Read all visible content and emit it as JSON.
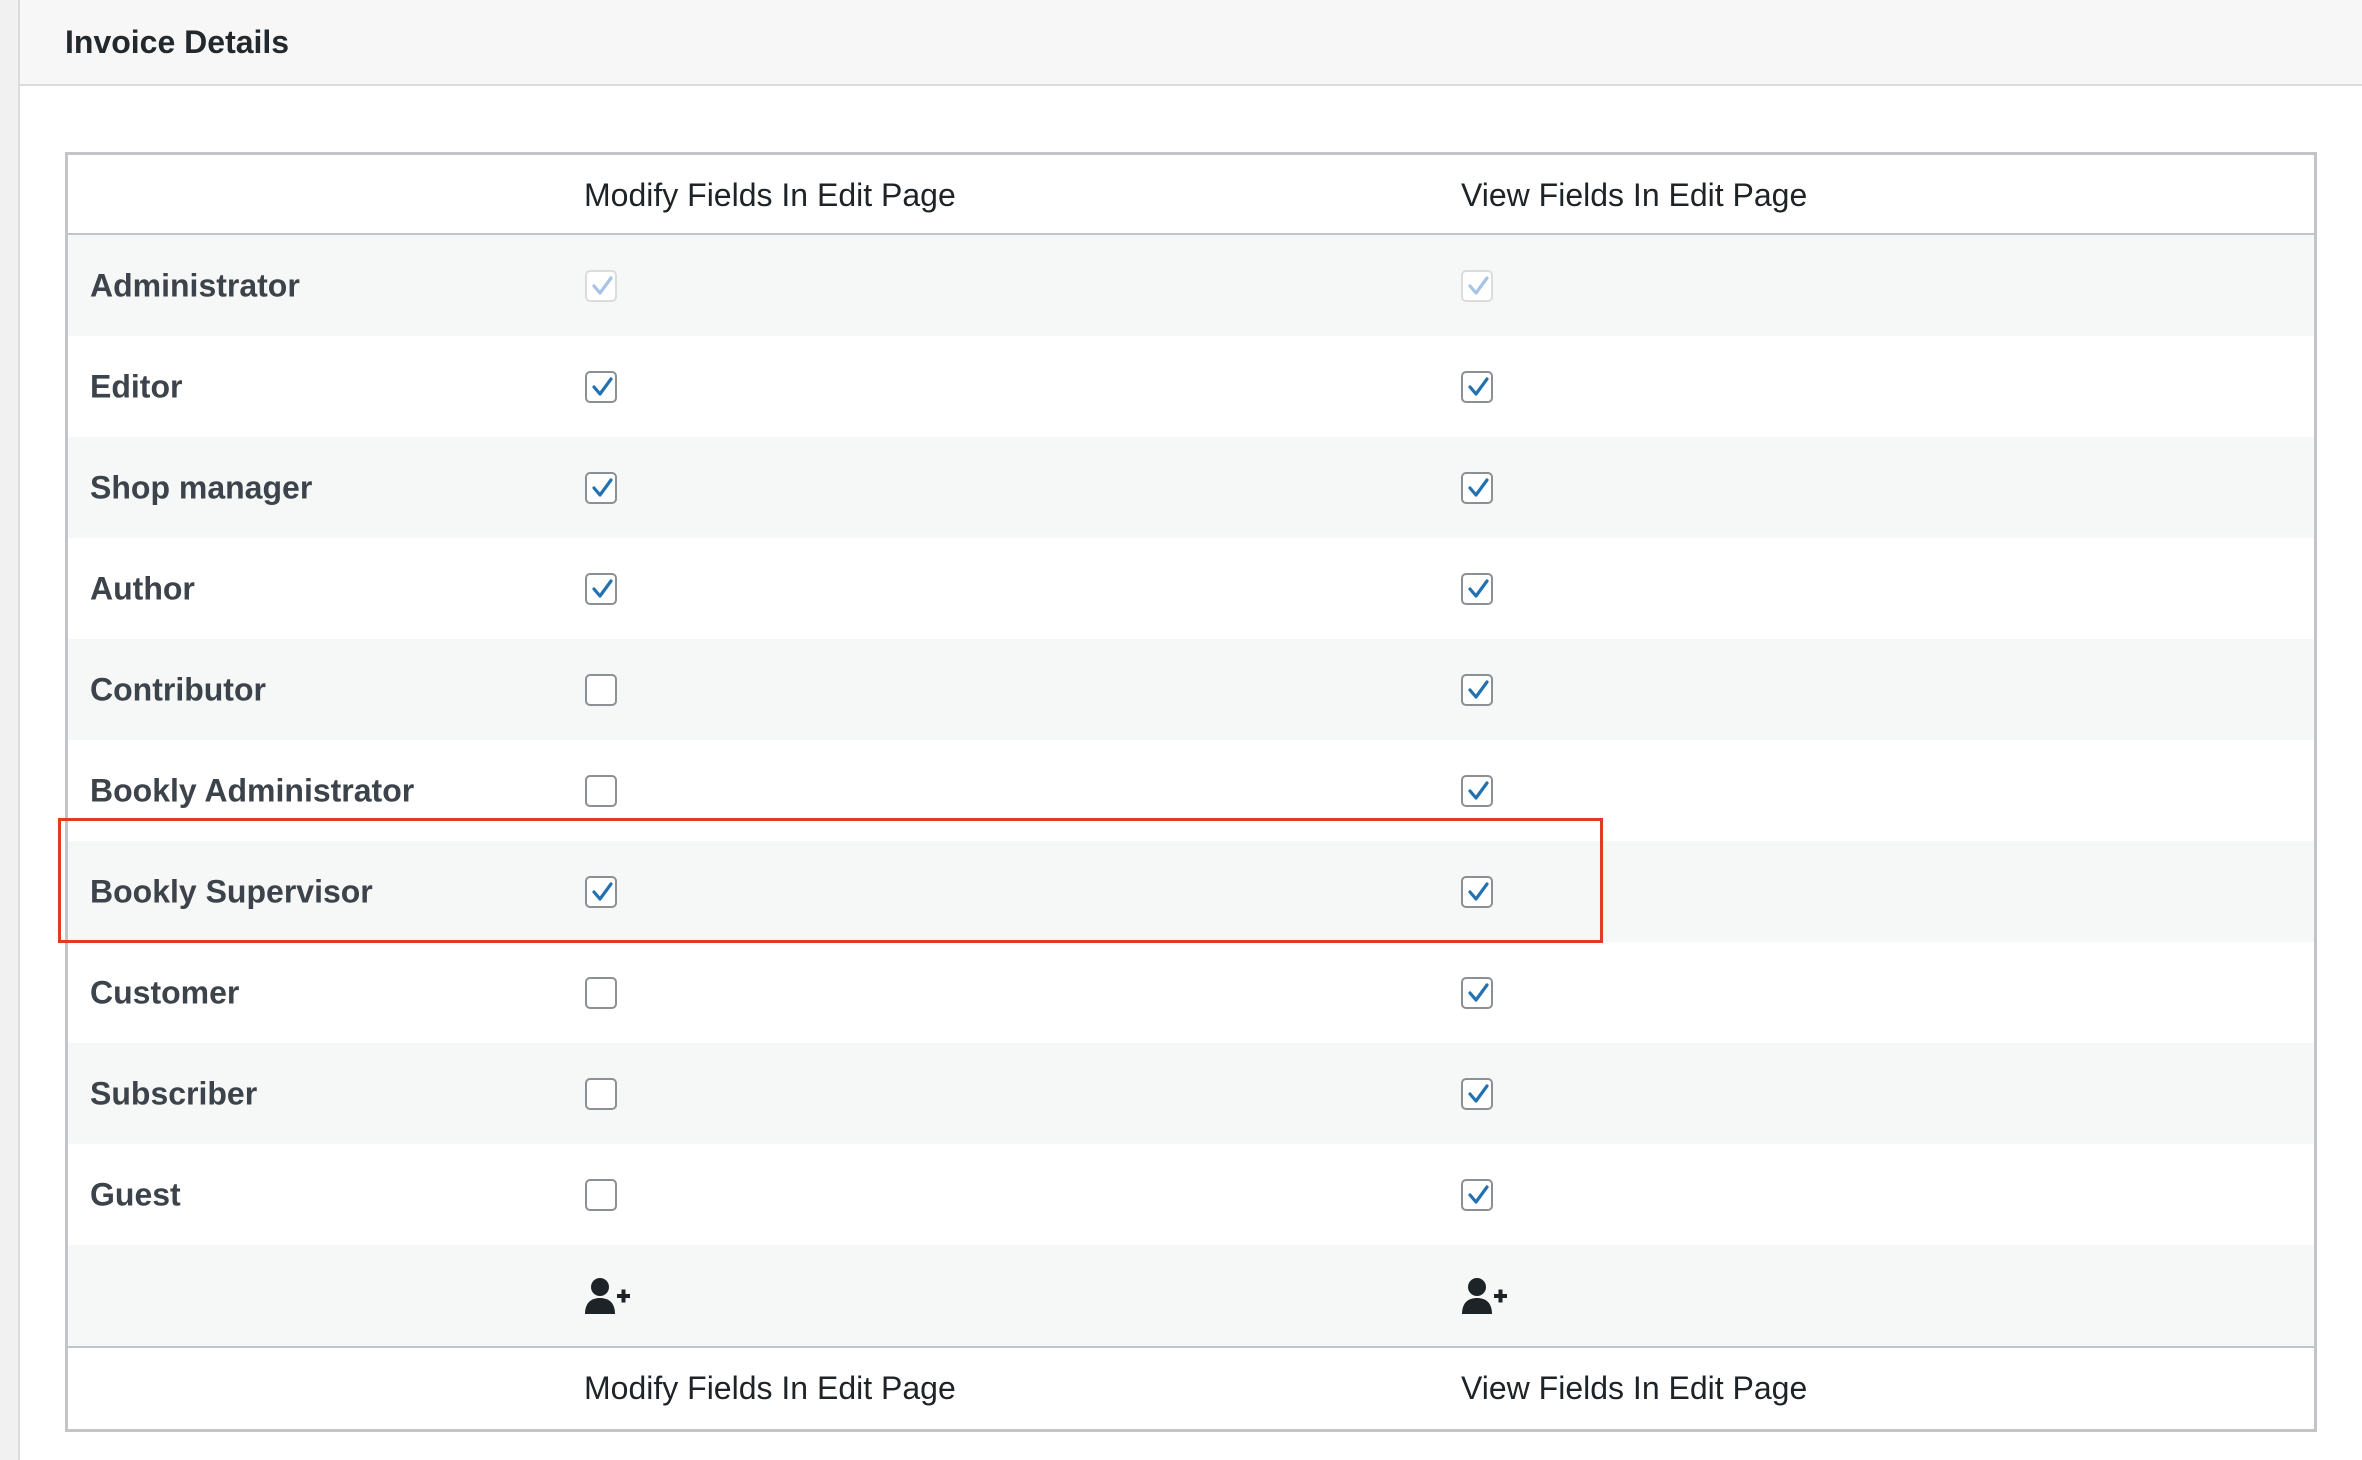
{
  "panel": {
    "title": "Invoice Details"
  },
  "table": {
    "header": {
      "col_modify": "Modify Fields In Edit Page",
      "col_view": "View Fields In Edit Page"
    },
    "footer": {
      "col_modify": "Modify Fields In Edit Page",
      "col_view": "View Fields In Edit Page"
    },
    "rows": [
      {
        "role": "Administrator",
        "modify": true,
        "view": true,
        "disabled": true
      },
      {
        "role": "Editor",
        "modify": true,
        "view": true
      },
      {
        "role": "Shop manager",
        "modify": true,
        "view": true
      },
      {
        "role": "Author",
        "modify": true,
        "view": true
      },
      {
        "role": "Contributor",
        "modify": false,
        "view": true
      },
      {
        "role": "Bookly Administrator",
        "modify": false,
        "view": true
      },
      {
        "role": "Bookly Supervisor",
        "modify": true,
        "view": true,
        "highlighted": true
      },
      {
        "role": "Customer",
        "modify": false,
        "view": true
      },
      {
        "role": "Subscriber",
        "modify": false,
        "view": true
      },
      {
        "role": "Guest",
        "modify": false,
        "view": true
      }
    ],
    "add_row_icons": [
      "user-plus-icon",
      "user-plus-icon"
    ]
  },
  "colors": {
    "highlight": "#e33a24",
    "check": "#2271b1",
    "alt_row": "#f6f7f7"
  }
}
